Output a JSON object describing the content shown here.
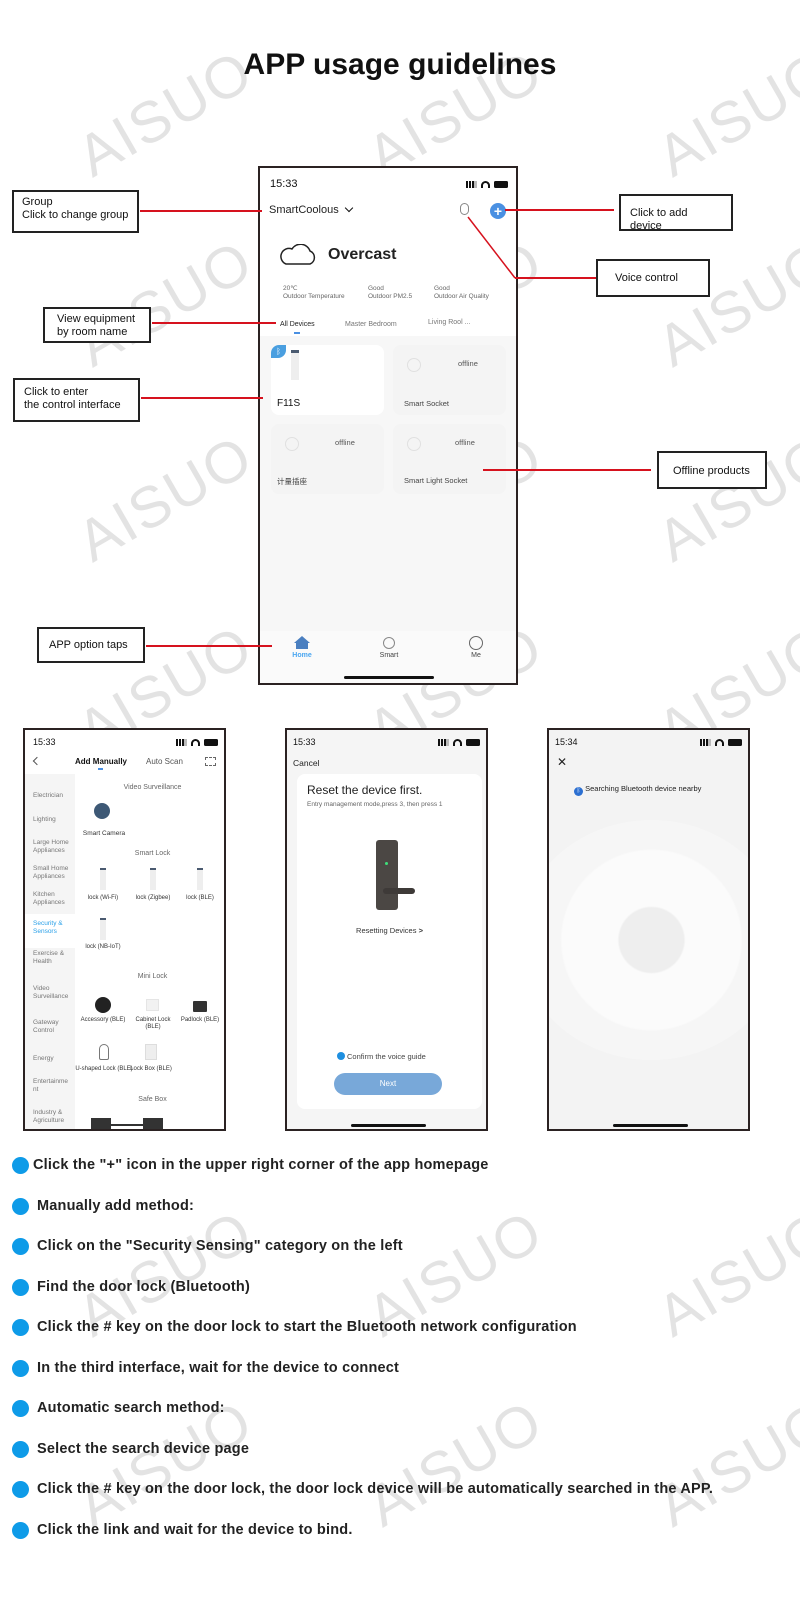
{
  "page_title": "APP usage guidelines",
  "watermark": "AISUO",
  "callouts": {
    "group_line1": "Group",
    "group_line2": "Click to change group",
    "view_line1": "View equipment",
    "view_line2": "by room name",
    "enter_line1": "Click to enter",
    "enter_line2": "the control interface",
    "tabs": "APP option taps",
    "add_device": "Click to add device",
    "voice": "Voice control",
    "offline": "Offline products"
  },
  "home_screen": {
    "time": "15:33",
    "group_name": "SmartCoolous",
    "weather": "Overcast",
    "stats": [
      {
        "value": "20℃",
        "label": "Outdoor Temperature"
      },
      {
        "value": "Good",
        "label": "Outdoor PM2.5"
      },
      {
        "value": "Good",
        "label": "Outdoor Air Quality"
      }
    ],
    "rooms": [
      "All Devices",
      "Master Bedroom",
      "Living Rool ..."
    ],
    "devices": [
      {
        "name": "F11S",
        "status": ""
      },
      {
        "name": "Smart Socket",
        "status": "offline"
      },
      {
        "name": "计量插座",
        "status": "offline"
      },
      {
        "name": "Smart Light Socket",
        "status": "offline"
      }
    ],
    "nav": [
      "Home",
      "Smart",
      "Me"
    ],
    "accent": "#4a90e2"
  },
  "add_screen": {
    "time": "15:33",
    "tab_active": "Add Manually",
    "tab_other": "Auto Scan",
    "categories": [
      "Electrician",
      "Lighting",
      "Large Home Appliances",
      "Small Home Appliances",
      "Kitchen Appliances",
      "Security & Sensors",
      "Exercise & Health",
      "Video Surveillance",
      "Gateway Control",
      "Energy",
      "Entertainment",
      "Industry & Agriculture"
    ],
    "selected_category": "Security & Sensors",
    "sections": {
      "video": "Video Surveillance",
      "smart_lock": "Smart Lock",
      "mini_lock": "Mini Lock",
      "safe_box": "Safe Box"
    },
    "video_devices": [
      "Smart Camera"
    ],
    "smart_lock_devices": [
      "lock (Wi-Fi)",
      "lock (Zigbee)",
      "lock (BLE)",
      "lock (NB-IoT)"
    ],
    "mini_lock_devices": [
      "Accessory (BLE)",
      "Cabinet Lock (BLE)",
      "Padlock (BLE)",
      "U-shaped Lock (BLE)",
      "Lock Box (BLE)"
    ]
  },
  "reset_screen": {
    "time": "15:33",
    "cancel": "Cancel",
    "heading": "Reset the device first.",
    "instructions": "Entry management mode,press 3, then press 1",
    "link": "Resetting Devices",
    "confirm": "Confirm the voice guide",
    "next": "Next"
  },
  "search_screen": {
    "time": "15:34",
    "status": "Searching Bluetooth device nearby"
  },
  "steps": [
    "Click the \"+\" icon in the upper right corner of the app homepage",
    "Manually add method:",
    "Click on the \"Security Sensing\" category on the left",
    "Find the door lock (Bluetooth)",
    "Click the # key on the door lock to start the Bluetooth network configuration",
    "In the third interface, wait for the device to connect",
    "Automatic search method:",
    "Select the search device page",
    "Click the # key on the door lock, the door lock device will be automatically searched in the APP.",
    "Click the link and wait for the device to bind."
  ]
}
